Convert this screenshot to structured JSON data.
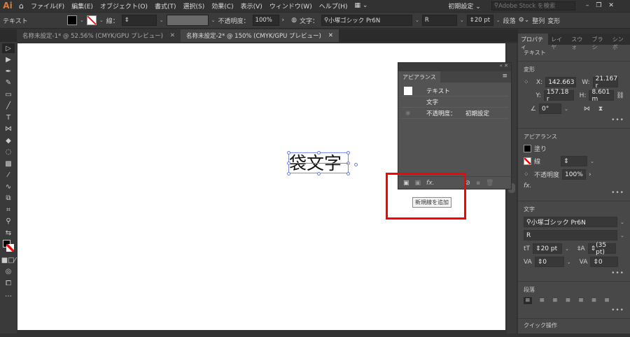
{
  "app": {
    "logo": "Ai"
  },
  "menu": [
    "ファイル(F)",
    "編集(E)",
    "オブジェクト(O)",
    "書式(T)",
    "選択(S)",
    "効果(C)",
    "表示(V)",
    "ウィンドウ(W)",
    "ヘルプ(H)"
  ],
  "workspace": "初期設定",
  "stock_search_placeholder": "Adobe Stock を検索",
  "control": {
    "type": "テキスト",
    "stroke_label": "線：",
    "opacity_label": "不透明度：",
    "opacity": "100%",
    "char_label": "文字：",
    "font": "小塚ゴシック Pr6N",
    "style": "R",
    "size": "20 pt",
    "paragraph": "段落",
    "align": "整列",
    "transform": "変形"
  },
  "tabs": [
    {
      "label": "名称未設定-1* @ 52.56% (CMYK/GPU プレビュー)"
    },
    {
      "label": "名称未設定-2* @ 150% (CMYK/GPU プレビュー)"
    }
  ],
  "canvas_text": "袋文字",
  "appearance_panel": {
    "title": "アピアランス",
    "rows": [
      "テキスト",
      "文字"
    ],
    "opacity_label": "不透明度：",
    "opacity_value": "初期設定",
    "tooltip": "新規線を追加"
  },
  "right_panel": {
    "tabs": [
      "プロパティ",
      "レイヤ",
      "スウォ",
      "ブラシ",
      "シンボ"
    ],
    "object_type": "テキスト",
    "transform": {
      "title": "変形",
      "x": "142.663",
      "y": "157.18 r",
      "w": "21.167 r",
      "h": "8.601 m",
      "angle": "0°"
    },
    "appearance": {
      "title": "アピアランス",
      "fill": "塗り",
      "stroke": "線",
      "opacity_label": "不透明度",
      "opacity": "100%"
    },
    "character": {
      "title": "文字",
      "font": "小塚ゴシック Pr6N",
      "style": "R",
      "size": "20 pt",
      "leading": "(35 pt)",
      "kerning": "0",
      "tracking": "0"
    },
    "paragraph": {
      "title": "段落"
    },
    "quick": "クイック操作"
  },
  "colors": {
    "highlight": "#ff0000",
    "selection": "#6a7fe6"
  }
}
